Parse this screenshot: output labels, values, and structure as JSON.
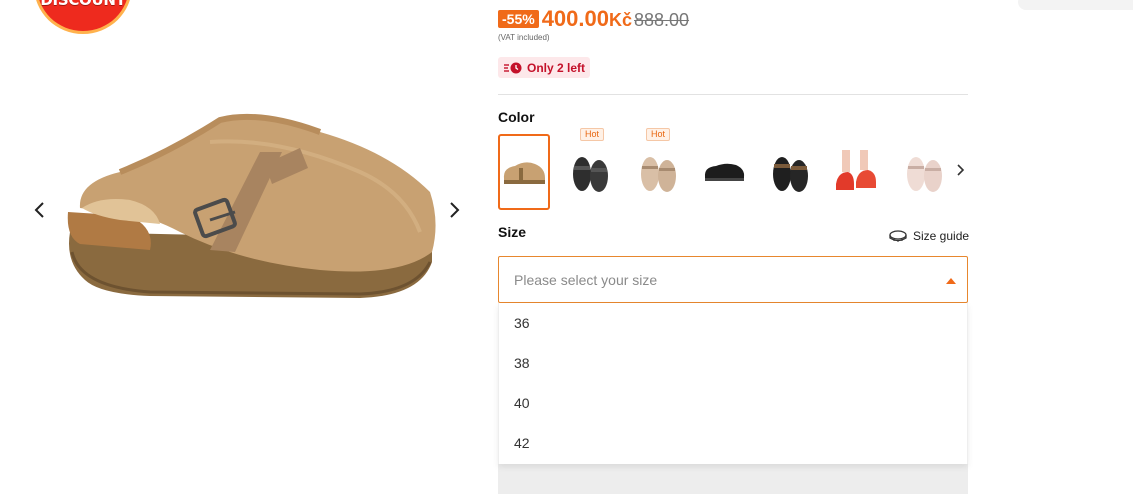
{
  "badge": {
    "label": "DISCOUNT"
  },
  "price": {
    "discount": "-55%",
    "current": "400.00",
    "currency": "Kč",
    "original": "888.00",
    "vat_note": "(VAT included)"
  },
  "stock": {
    "label": "Only 2 left"
  },
  "color": {
    "label": "Color",
    "swatches": [
      {
        "selected": true,
        "hot": false
      },
      {
        "selected": false,
        "hot": true,
        "tag": "Hot"
      },
      {
        "selected": false,
        "hot": true,
        "tag": "Hot"
      },
      {
        "selected": false,
        "hot": false
      },
      {
        "selected": false,
        "hot": false
      },
      {
        "selected": false,
        "hot": false
      },
      {
        "selected": false,
        "hot": false
      }
    ]
  },
  "size": {
    "label": "Size",
    "guide_label": "Size guide",
    "placeholder": "Please select your size",
    "options": [
      "36",
      "38",
      "40",
      "42"
    ]
  },
  "colors": {
    "accent": "#f06a19",
    "stock_red": "#c4112a",
    "badge_red": "#ee2a1e"
  },
  "icons": [
    "chevron-left-icon",
    "chevron-right-icon",
    "clock-icon",
    "tape-measure-icon",
    "caret-up-icon"
  ]
}
